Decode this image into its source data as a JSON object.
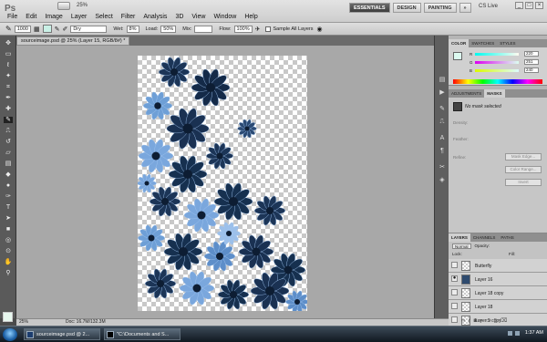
{
  "app": {
    "logo": "Ps"
  },
  "menu": [
    "File",
    "Edit",
    "Image",
    "Layer",
    "Select",
    "Filter",
    "Analysis",
    "3D",
    "View",
    "Window",
    "Help"
  ],
  "topbar": {
    "zoom": "25%",
    "workspaces": [
      "ESSENTIALS",
      "DESIGN",
      "PAINTING"
    ],
    "more": "»",
    "cslive": "CS Live"
  },
  "options": {
    "brush_size": "1000",
    "mode_value": "Dry",
    "wet_label": "Wet:",
    "wet_value": "8%",
    "load_label": "Load:",
    "load_value": "50%",
    "mix_label": "Mix:",
    "flow_label": "Flow:",
    "flow_value": "100%",
    "sample_label": "Sample All Layers"
  },
  "document": {
    "tab_label": "sourceimage.psd @ 25% (Layer 15, RGB/8#) *",
    "status_zoom": "25%",
    "status_doc": "Doc: 16.7M/132.3M"
  },
  "color_panel": {
    "tabs": [
      "COLOR",
      "SWATCHES",
      "STYLES"
    ],
    "r_label": "R",
    "r_value": "220",
    "g_label": "G",
    "g_value": "251",
    "b_label": "B",
    "b_value": "240",
    "accent": "#dcfbf0"
  },
  "adjust_panel": {
    "tabs": [
      "ADJUSTMENTS",
      "MASKS"
    ],
    "mask_label": "No mask selected",
    "density_label": "Density:",
    "feather_label": "Feather:",
    "refine_label": "Refine:",
    "mask_edge": "Mask Edge...",
    "color_range": "Color Range...",
    "invert": "Invert"
  },
  "layers_panel": {
    "tabs": [
      "LAYERS",
      "CHANNELS",
      "PATHS"
    ],
    "blend": "Normal",
    "opacity_label": "Opacity:",
    "lock_label": "Lock:",
    "fill_label": "Fill:",
    "layers": [
      {
        "name": "Butterfly",
        "visible": false,
        "selected": false
      },
      {
        "name": "Layer 16",
        "visible": true,
        "selected": true
      },
      {
        "name": "Layer 18 copy",
        "visible": false,
        "selected": false
      },
      {
        "name": "Layer 18",
        "visible": false,
        "selected": false
      },
      {
        "name": "Layer 9 copy",
        "visible": false,
        "selected": false
      }
    ]
  },
  "taskbar": {
    "items": [
      "sourceimage.psd @ 2...",
      "\"C:\\Documents and S..."
    ],
    "clock": "1:37 AM"
  }
}
